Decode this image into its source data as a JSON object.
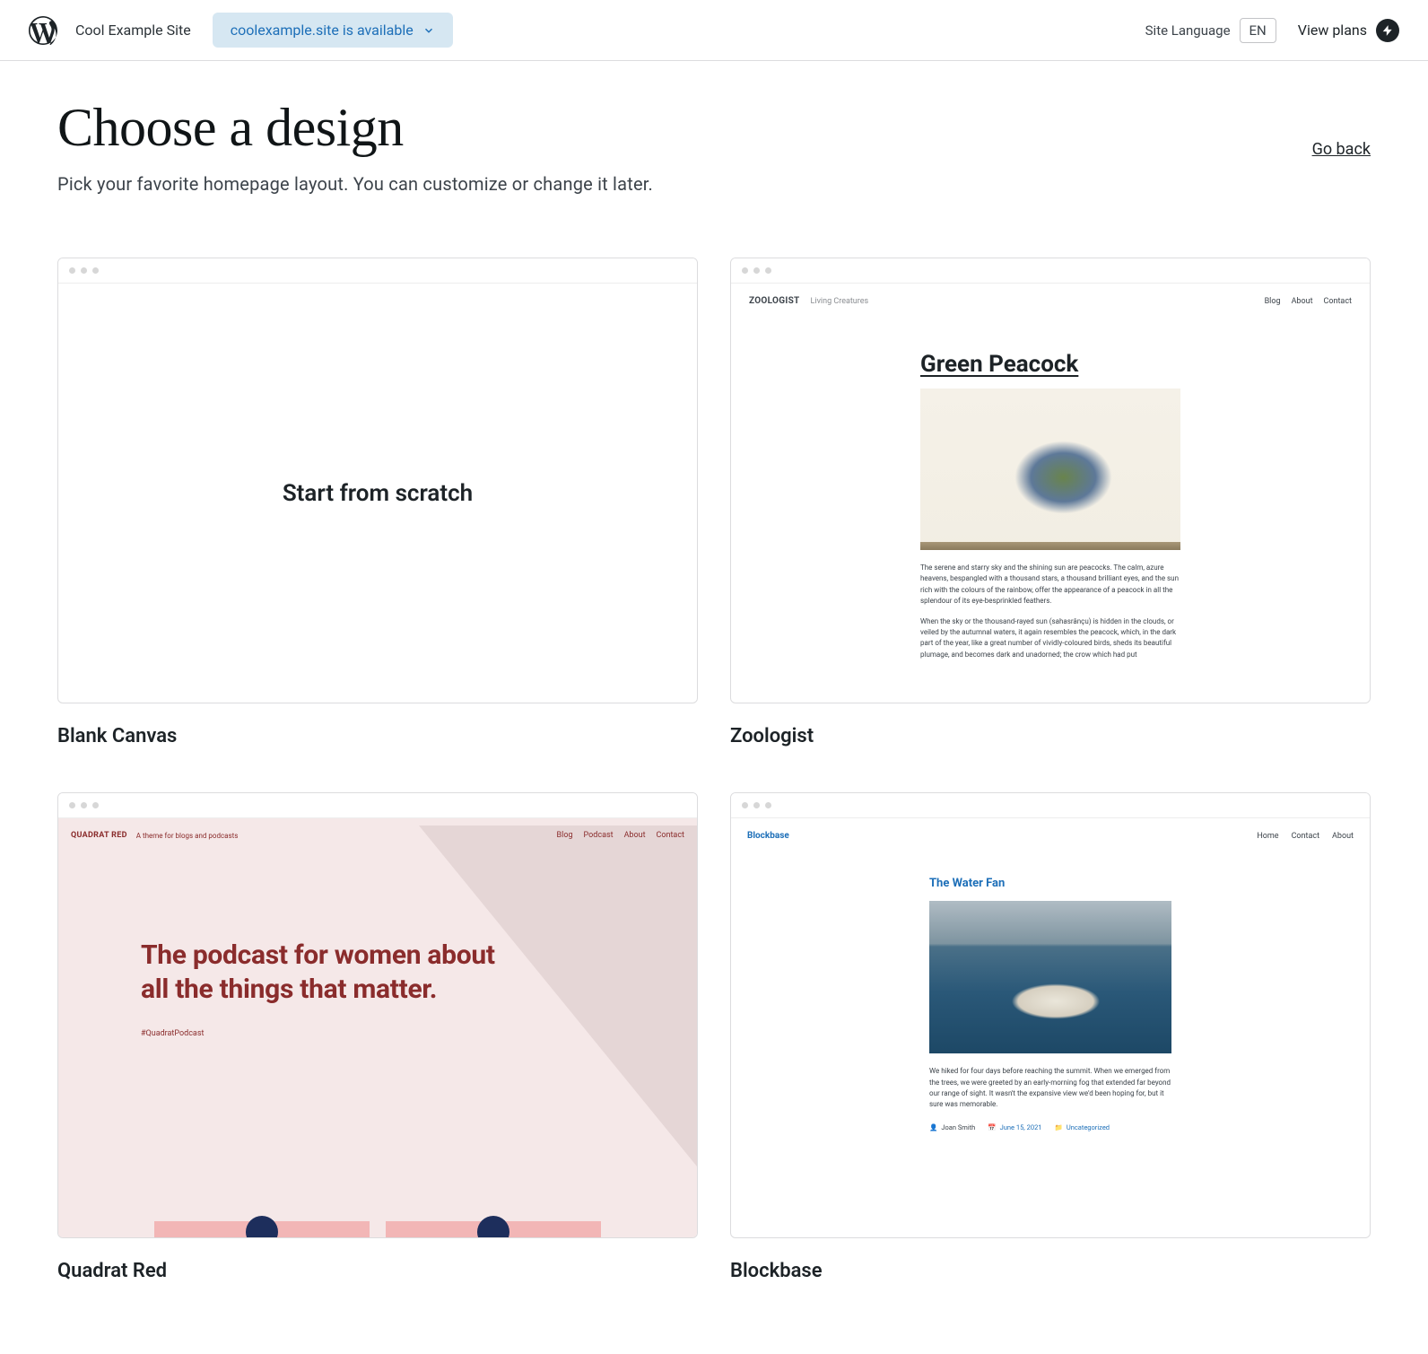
{
  "header": {
    "site_name": "Cool Example Site",
    "domain_status": "coolexample.site is available",
    "language_label": "Site Language",
    "language_code": "EN",
    "view_plans": "View plans"
  },
  "page": {
    "title": "Choose a design",
    "subtitle": "Pick your favorite homepage layout. You can customize or change it later.",
    "go_back": "Go back"
  },
  "themes": [
    {
      "name": "Blank Canvas",
      "scratch_label": "Start from scratch"
    },
    {
      "name": "Zoologist",
      "preview": {
        "brand": "ZOOLOGIST",
        "tagline": "Living Creatures",
        "nav": [
          "Blog",
          "About",
          "Contact"
        ],
        "post_title": "Green Peacock",
        "para1": "The serene and starry sky and the shining sun are peacocks. The calm, azure heavens, bespangled with a thousand stars, a thousand brilliant eyes, and the sun rich with the colours of the rainbow, offer the appearance of a peacock in all the splendour of its eye-besprinkled feathers.",
        "para2": "When the sky or the thousand-rayed sun (sahasrânçu) is hidden in the clouds, or veiled by the autumnal waters, it again resembles the peacock, which, in the dark part of the year, like a great number of vividly-coloured birds, sheds its beautiful plumage, and becomes dark and unadorned; the crow which had put"
      }
    },
    {
      "name": "Quadrat Red",
      "preview": {
        "brand": "QUADRAT RED",
        "tagline": "A theme for blogs and podcasts",
        "nav": [
          "Blog",
          "Podcast",
          "About",
          "Contact"
        ],
        "hero": "The podcast for women about all the things that matter.",
        "hashtag": "#QuadratPodcast"
      }
    },
    {
      "name": "Blockbase",
      "preview": {
        "brand": "Blockbase",
        "nav": [
          "Home",
          "Contact",
          "About"
        ],
        "post_title": "The Water Fan",
        "para": "We hiked for four days before reaching the summit. When we emerged from the trees, we were greeted by an early-morning fog that extended far beyond our range of sight. It wasn't the expansive view we'd been hoping for, but it sure was memorable.",
        "author": "Joan Smith",
        "date": "June 15, 2021",
        "category": "Uncategorized"
      }
    }
  ]
}
